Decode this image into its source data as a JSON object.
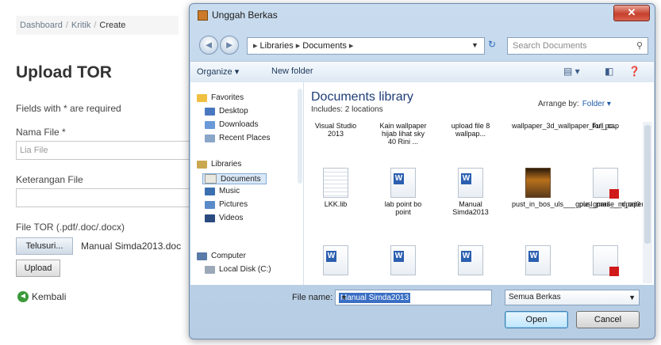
{
  "page": {
    "breadcrumb": [
      "Dashboard",
      "Kritik",
      "Create"
    ],
    "title": "Upload TOR",
    "required_note": "Fields with * are required",
    "fields": [
      {
        "label": "Nama File *",
        "value": "Lia File"
      },
      {
        "label": "Keterangan File",
        "value": ""
      },
      {
        "label": "File TOR (.pdf/.doc/.docx)",
        "value": ""
      }
    ],
    "browse_label": "Telusuri...",
    "chosen_file": "Manual Simda2013.doc",
    "upload_label": "Upload",
    "back_label": "Kembali",
    "back_icon": "arrow-left-icon",
    "colors": {
      "back_icon_bg": "#3b9a3b"
    }
  },
  "dialog": {
    "title": "Unggah Berkas",
    "close_label": "✕",
    "path": [
      "Libraries",
      "Documents"
    ],
    "search_placeholder": "Search Documents",
    "toolbar": {
      "organize": "Organize ▾",
      "new_folder": "New folder"
    },
    "nav": {
      "favorites": "Favorites",
      "desktop": "Desktop",
      "downloads": "Downloads",
      "recent": "Recent Places",
      "libraries": "Libraries",
      "documents": "Documents",
      "music": "Music",
      "pictures": "Pictures",
      "videos": "Videos",
      "computer": "Computer",
      "local_disk": "Local Disk (C:)"
    },
    "library_title": "Documents library",
    "library_sub": "Includes: 2 locations",
    "arrange_label": "Arrange by:",
    "arrange_value": "Folder ▾",
    "files": [
      {
        "name": "Visual Studio 2013",
        "kind": "folder"
      },
      {
        "name": "Kain wallpaper hijab lihat sky 40 Rini ...",
        "kind": "folder"
      },
      {
        "name": "upload file 8 wallpap...",
        "kind": "folder"
      },
      {
        "name": "wallpaper_3d_wallpaper_for_pc...",
        "kind": "folder"
      },
      {
        "name": "Full_cap",
        "kind": "folder"
      },
      {
        "name": "LKK.lib",
        "kind": "txt"
      },
      {
        "name": "lab point bo point",
        "kind": "word"
      },
      {
        "name": "Manual Simda2013",
        "kind": "word"
      },
      {
        "name": "pust_in_bos_uls___gple_gmail___dpaper_...",
        "kind": "img"
      },
      {
        "name": "pusl_parse_m_ori0",
        "kind": "pdf"
      },
      {
        "name": "",
        "kind": "word"
      },
      {
        "name": "",
        "kind": "word"
      },
      {
        "name": "",
        "kind": "word"
      },
      {
        "name": "",
        "kind": "word"
      },
      {
        "name": "",
        "kind": "pdf"
      }
    ],
    "filename_label": "File name:",
    "filename_value": "Manual Simda2013",
    "filetype_value": "Semua Berkas",
    "open_label": "Open",
    "cancel_label": "Cancel"
  }
}
